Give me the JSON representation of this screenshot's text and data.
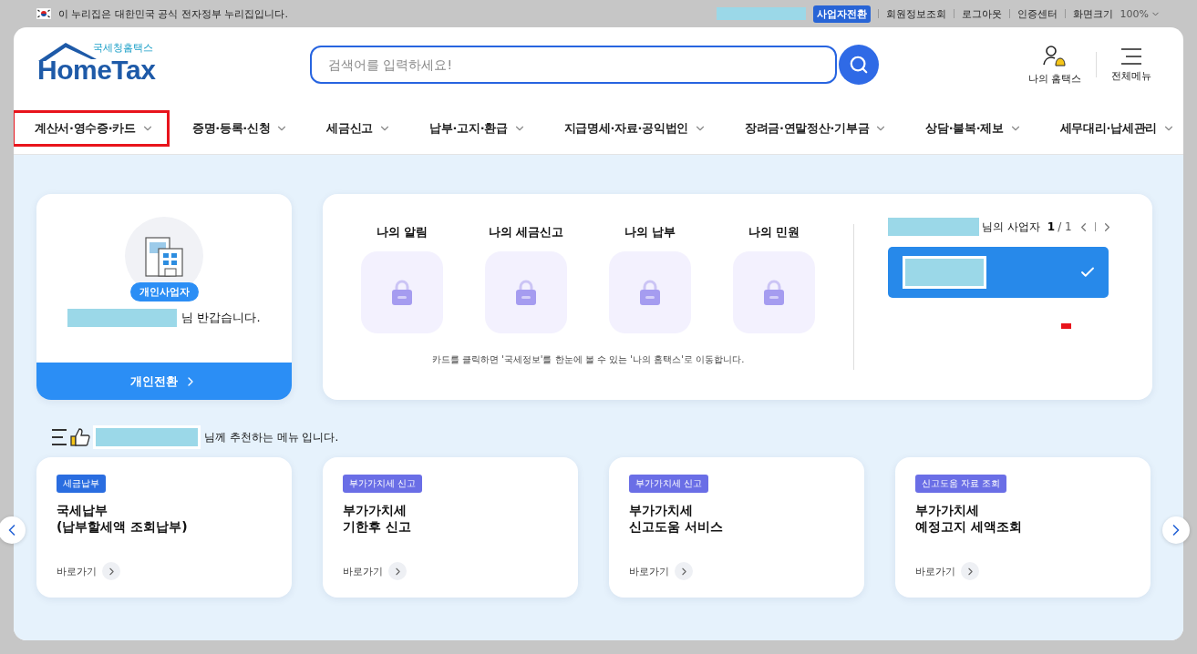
{
  "top_bar": {
    "notice": "이 누리집은 대한민국 공식 전자정부 누리집입니다.",
    "switch_button": "사업자전환",
    "links": [
      "회원정보조회",
      "로그아웃",
      "인증센터"
    ],
    "zoom_label": "화면크기",
    "zoom_value": "100%"
  },
  "header": {
    "logo_small": "국세청홈택스",
    "logo_big": "HomeTax",
    "search_placeholder": "검색어를 입력하세요!",
    "shortcuts": [
      {
        "kind": "user",
        "label": "나의 홈택스"
      },
      {
        "kind": "menu",
        "label": "전체메뉴"
      }
    ]
  },
  "nav": [
    {
      "label": "계산서·영수증·카드",
      "highlighted": true
    },
    {
      "label": "증명·등록·신청",
      "highlighted": false
    },
    {
      "label": "세금신고",
      "highlighted": false
    },
    {
      "label": "납부·고지·환급",
      "highlighted": false
    },
    {
      "label": "지급명세·자료·공익법인",
      "highlighted": false
    },
    {
      "label": "장려금·연말정산·기부금",
      "highlighted": false
    },
    {
      "label": "상담·불복·제보",
      "highlighted": false
    },
    {
      "label": "세무대리·납세관리",
      "highlighted": false
    }
  ],
  "profile": {
    "badge": "개인사업자",
    "greeting": "님 반갑습니다.",
    "switch_button": "개인전환"
  },
  "my_cards": {
    "items": [
      {
        "label": "나의 알림"
      },
      {
        "label": "나의 세금신고"
      },
      {
        "label": "나의 납부"
      },
      {
        "label": "나의 민원"
      }
    ],
    "note": "카드를 클릭하면 '국세정보'를 한눈에 볼 수 있는 '나의 홈택스'로 이동합니다."
  },
  "business": {
    "suffix": "님의 사업자",
    "page_current": "1",
    "page_total": "/ 1",
    "entries": [
      {
        "selected": true
      }
    ]
  },
  "recommend": {
    "title_suffix": "님께 추천하는 메뉴 입니다.",
    "cards": [
      {
        "tag": "세금납부",
        "color": "#2a6de0",
        "title": "국세납부\n(납부할세액 조회납부)",
        "link": "바로가기"
      },
      {
        "tag": "부가가치세 신고",
        "color": "#6a6ee6",
        "title": "부가가치세\n기한후 신고",
        "link": "바로가기"
      },
      {
        "tag": "부가가치세 신고",
        "color": "#6a6ee6",
        "title": "부가가치세\n신고도움 서비스",
        "link": "바로가기"
      },
      {
        "tag": "신고도움 자료 조회",
        "color": "#6a6ee6",
        "title": "부가가치세\n예정고지 세액조회",
        "link": "바로가기"
      }
    ]
  }
}
